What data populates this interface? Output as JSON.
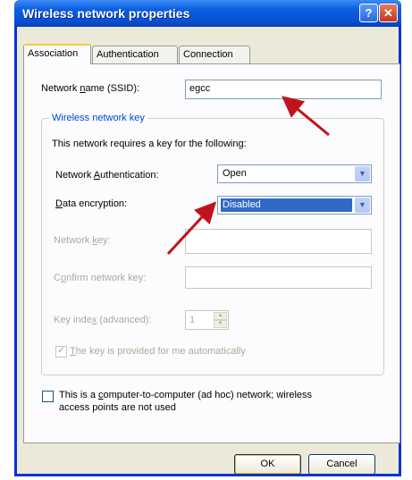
{
  "window": {
    "title": "Wireless network properties",
    "help_glyph": "?",
    "close_glyph": "✕"
  },
  "tabs": [
    {
      "label": "Association",
      "active": true
    },
    {
      "label": "Authentication",
      "active": false
    },
    {
      "label": "Connection",
      "active": false
    }
  ],
  "ssid": {
    "label_pre": "Network ",
    "label_u": "n",
    "label_post": "ame (SSID):",
    "value": "egcc"
  },
  "group": {
    "title": "Wireless network key",
    "intro": "This network requires a key for the following:",
    "auth": {
      "label_pre": "Network ",
      "label_u": "A",
      "label_post": "uthentication:",
      "value": "Open"
    },
    "encryption": {
      "label_pre": "",
      "label_u": "D",
      "label_post": "ata encryption:",
      "value": "Disabled"
    },
    "network_key": {
      "label_pre": "Network ",
      "label_u": "k",
      "label_post": "ey:"
    },
    "confirm_key": {
      "label_pre": "C",
      "label_u": "o",
      "label_post": "nfirm network key:"
    },
    "key_index": {
      "label_pre": "Key inde",
      "label_u": "x",
      "label_post": " (advanced):",
      "value": "1"
    },
    "auto_key": {
      "label_pre": "",
      "label_u": "T",
      "label_post": "he key is provided for me automatically",
      "checked": true
    }
  },
  "adhoc": {
    "line1_pre": "This is a ",
    "line1_u": "c",
    "line1_post": "omputer-to-computer (ad hoc) network; wireless",
    "line2": "access points are not used",
    "checked": false
  },
  "buttons": {
    "ok": "OK",
    "cancel": "Cancel"
  },
  "colors": {
    "annotation_arrow": "#c0141c",
    "titlebar": "#0a54d6",
    "selection": "#316ac5"
  }
}
